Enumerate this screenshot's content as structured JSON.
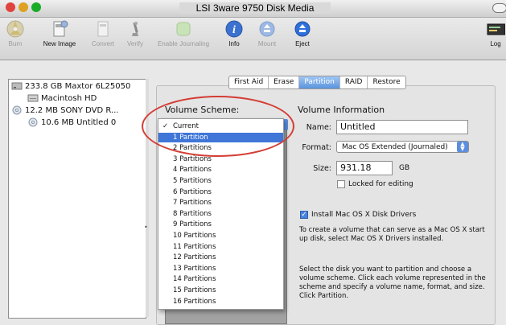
{
  "window": {
    "title": "LSI 3ware 9750 Disk Media",
    "traffic_colors": [
      "#e0443e",
      "#dea123",
      "#1aab29"
    ]
  },
  "toolbar": {
    "items": [
      {
        "label": "Burn",
        "icon": "burn-icon",
        "enabled": false
      },
      {
        "label": "New Image",
        "icon": "new-image-icon",
        "enabled": true
      },
      {
        "label": "Convert",
        "icon": "convert-icon",
        "enabled": false
      },
      {
        "label": "Verify",
        "icon": "verify-icon",
        "enabled": false
      },
      {
        "label": "Enable Journaling",
        "icon": "enable-journaling-icon",
        "enabled": false
      },
      {
        "label": "Info",
        "icon": "info-icon",
        "enabled": true
      },
      {
        "label": "Mount",
        "icon": "mount-icon",
        "enabled": false
      },
      {
        "label": "Eject",
        "icon": "eject-icon",
        "enabled": true
      },
      {
        "label": "Log",
        "icon": "log-icon",
        "enabled": true
      }
    ]
  },
  "sidebar": {
    "disks": [
      {
        "label": "233.8 GB Maxtor 6L25050",
        "icon": "hard-disk-icon"
      },
      {
        "label": "Macintosh HD",
        "icon": "volume-icon"
      },
      {
        "label": "12.2 MB SONY    DVD R...",
        "icon": "optical-drive-icon"
      },
      {
        "label": "10.6 MB Untitled 0",
        "icon": "disc-icon"
      }
    ]
  },
  "tabs": [
    {
      "label": "First Aid",
      "active": false
    },
    {
      "label": "Erase",
      "active": false
    },
    {
      "label": "Partition",
      "active": true
    },
    {
      "label": "RAID",
      "active": false
    },
    {
      "label": "Restore",
      "active": false
    }
  ],
  "volume_scheme": {
    "label": "Volume Scheme:",
    "checked": "Current",
    "selected": "1 Partition",
    "options": [
      "Current",
      "1 Partition",
      "2 Partitions",
      "3 Partitions",
      "4 Partitions",
      "5 Partitions",
      "6 Partitions",
      "7 Partitions",
      "8 Partitions",
      "9 Partitions",
      "10 Partitions",
      "11 Partitions",
      "12 Partitions",
      "13 Partitions",
      "14 Partitions",
      "15 Partitions",
      "16 Partitions"
    ]
  },
  "volume_info": {
    "heading": "Volume Information",
    "name_label": "Name:",
    "name_value": "Untitled",
    "format_label": "Format:",
    "format_value": "Mac OS Extended (Journaled)",
    "size_label": "Size:",
    "size_value": "931.18",
    "size_unit": "GB",
    "locked_label": "Locked for editing",
    "locked_checked": false,
    "install_label": "Install Mac OS X Disk Drivers",
    "install_checked": true,
    "install_help": "To create a volume that can serve as a Mac OS X start up disk, select Mac OS X Drivers installed.",
    "partition_help": "Select the disk you want to partition and choose a volume scheme. Click each volume represented in the scheme and specify a volume name, format, and size. Click Partition."
  },
  "annotation": {
    "color": "#d43c34"
  },
  "colors": {
    "selection": "#3f76d8",
    "tab_active": "#5b93dd"
  }
}
